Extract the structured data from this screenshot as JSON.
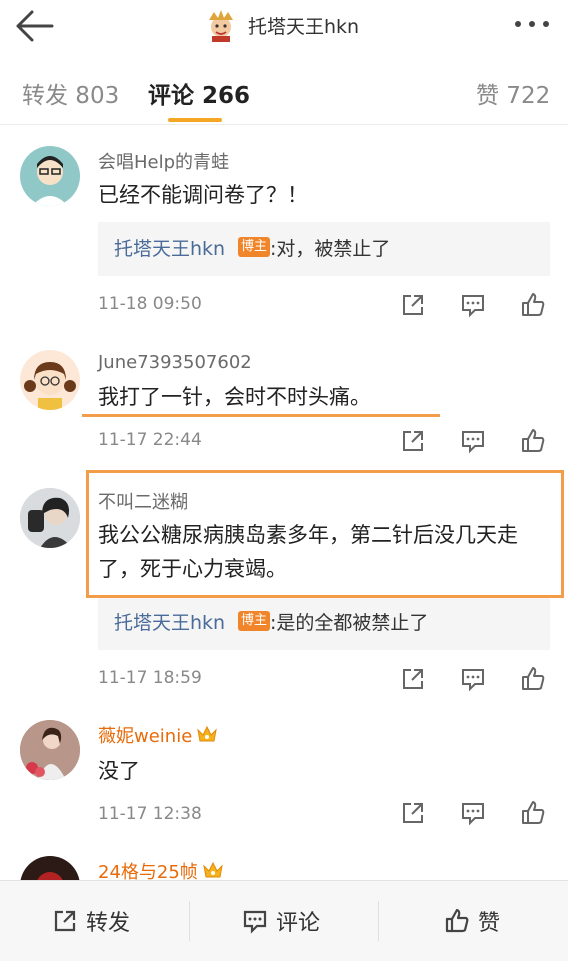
{
  "header": {
    "title": "托塔天王hkn"
  },
  "tabs": [
    {
      "label": "转发 803"
    },
    {
      "label": "评论 266"
    },
    {
      "label": "赞 722"
    }
  ],
  "comments": [
    {
      "user": "会唱Help的青蛙",
      "text": "已经不能调问卷了？！",
      "reply": {
        "user": "托塔天王hkn",
        "badge": "博主",
        "text": ":对，被禁止了"
      },
      "time": "11-18 09:50"
    },
    {
      "user": "June7393507602",
      "text": "我打了一针，会时不时头痛。",
      "time": "11-17 22:44"
    },
    {
      "user": "不叫二迷糊",
      "text": "我公公糖尿病胰岛素多年，第二针后没几天走了，死于心力衰竭。",
      "reply": {
        "user": "托塔天王hkn",
        "badge": "博主",
        "text": ":是的全都被禁止了"
      },
      "time": "11-17 18:59"
    },
    {
      "user": "薇妮weinie",
      "text": "没了",
      "time": "11-17 12:38"
    },
    {
      "user": "24格与25帧"
    }
  ],
  "bottom": {
    "repost": "转发",
    "comment": "评论",
    "like": "赞"
  },
  "colors": {
    "accent": "#f5a623",
    "highlight": "#f39c4a",
    "vip_name": "#e86b0a",
    "reply_name": "#4a6b99"
  }
}
